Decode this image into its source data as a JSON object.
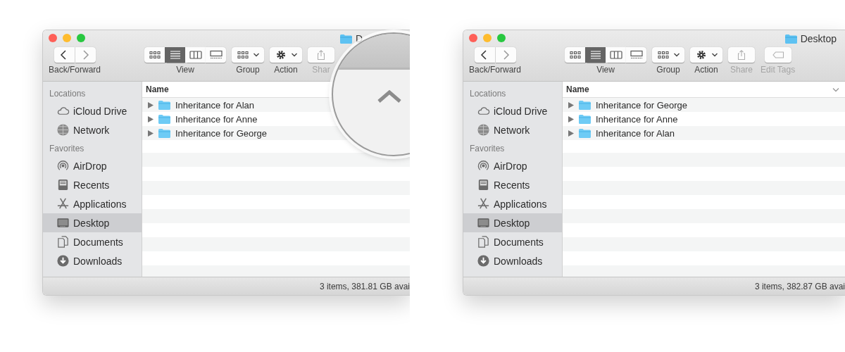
{
  "windows": [
    {
      "title": "D",
      "sort_indicator": false,
      "toolbar": [
        {
          "kind": "nav",
          "label": "Back/Forward",
          "disabled": false
        },
        {
          "kind": "view",
          "label": "View",
          "disabled": false,
          "segments": [
            {
              "kind": "icons",
              "selected": false
            },
            {
              "kind": "list",
              "selected": true
            },
            {
              "kind": "columns",
              "selected": false
            },
            {
              "kind": "gallery",
              "selected": false
            }
          ]
        },
        {
          "kind": "group",
          "label": "Group",
          "disabled": false
        },
        {
          "kind": "action",
          "label": "Action",
          "disabled": false
        },
        {
          "kind": "share",
          "label": "Shar",
          "disabled": true
        }
      ],
      "sidebar": [
        {
          "heading": "Locations",
          "items": [
            {
              "kind": "cloud",
              "label": "iCloud Drive",
              "selected": false
            },
            {
              "kind": "network",
              "label": "Network",
              "selected": false
            }
          ]
        },
        {
          "heading": "Favorites",
          "items": [
            {
              "kind": "airdrop",
              "label": "AirDrop",
              "selected": false
            },
            {
              "kind": "recents",
              "label": "Recents",
              "selected": false
            },
            {
              "kind": "applications",
              "label": "Applications",
              "selected": false
            },
            {
              "kind": "desktop",
              "label": "Desktop",
              "selected": true
            },
            {
              "kind": "documents",
              "label": "Documents",
              "selected": false
            },
            {
              "kind": "downloads",
              "label": "Downloads",
              "selected": false
            }
          ]
        }
      ],
      "column": "Name",
      "files": [
        {
          "name": "Inheritance for Alan",
          "expanded": false
        },
        {
          "name": "Inheritance for Anne",
          "expanded": false
        },
        {
          "name": "Inheritance for George",
          "expanded": false
        }
      ],
      "status": "3 items, 381.81 GB avai"
    },
    {
      "title": "Desktop",
      "sort_indicator": true,
      "toolbar": [
        {
          "kind": "nav",
          "label": "Back/Forward",
          "disabled": false
        },
        {
          "kind": "view",
          "label": "View",
          "disabled": false,
          "segments": [
            {
              "kind": "icons",
              "selected": false
            },
            {
              "kind": "list",
              "selected": true
            },
            {
              "kind": "columns",
              "selected": false
            },
            {
              "kind": "gallery",
              "selected": false
            }
          ]
        },
        {
          "kind": "group",
          "label": "Group",
          "disabled": false
        },
        {
          "kind": "action",
          "label": "Action",
          "disabled": false
        },
        {
          "kind": "share",
          "label": "Share",
          "disabled": true
        },
        {
          "kind": "tags",
          "label": "Edit Tags",
          "disabled": true
        }
      ],
      "sidebar": [
        {
          "heading": "Locations",
          "items": [
            {
              "kind": "cloud",
              "label": "iCloud Drive",
              "selected": false
            },
            {
              "kind": "network",
              "label": "Network",
              "selected": false
            }
          ]
        },
        {
          "heading": "Favorites",
          "items": [
            {
              "kind": "airdrop",
              "label": "AirDrop",
              "selected": false
            },
            {
              "kind": "recents",
              "label": "Recents",
              "selected": false
            },
            {
              "kind": "applications",
              "label": "Applications",
              "selected": false
            },
            {
              "kind": "desktop",
              "label": "Desktop",
              "selected": true
            },
            {
              "kind": "documents",
              "label": "Documents",
              "selected": false
            },
            {
              "kind": "downloads",
              "label": "Downloads",
              "selected": false
            }
          ]
        }
      ],
      "column": "Name",
      "files": [
        {
          "name": "Inheritance for George",
          "expanded": false
        },
        {
          "name": "Inheritance for Anne",
          "expanded": false
        },
        {
          "name": "Inheritance for Alan",
          "expanded": false
        }
      ],
      "status": "3 items, 382.87 GB avai"
    }
  ],
  "magnifier": {
    "shown": true
  }
}
